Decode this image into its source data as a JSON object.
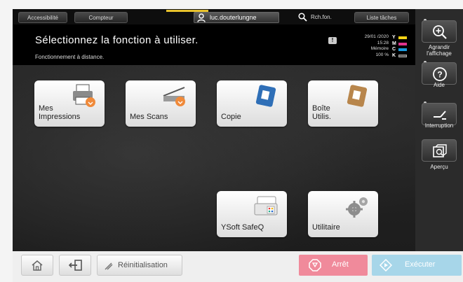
{
  "topbar": {
    "accessibility_label": "Accessibilité",
    "counter_label": "Compteur",
    "username": "luc.douterlungne",
    "search_label": "Rch.fon.",
    "job_list_label": "Liste tâches"
  },
  "header": {
    "title": "Sélectionnez la fonction à utiliser.",
    "subtitle": "Fonctionnement à distance.",
    "warning_glyph": "!",
    "date": "29/01 /2020",
    "time": "15:28",
    "memory_label": "Mémoire",
    "memory_value": "100 %",
    "toner": [
      {
        "letter": "Y",
        "color": "#f5d316"
      },
      {
        "letter": "M",
        "color": "#e0338d"
      },
      {
        "letter": "C",
        "color": "#1a9be0"
      },
      {
        "letter": "K",
        "color": "#555555"
      }
    ]
  },
  "tiles": [
    {
      "label_line1": "Mes",
      "label_line2": "Impressions",
      "icon": "printer-icon"
    },
    {
      "label_line1": "Mes Scans",
      "label_line2": "",
      "icon": "scanner-icon"
    },
    {
      "label_line1": "Copie",
      "label_line2": "",
      "icon": "copy-icon"
    },
    {
      "label_line1": "Boîte",
      "label_line2": "Utilis.",
      "icon": "box-icon"
    },
    {
      "label_line1": "YSoft SafeQ",
      "label_line2": "",
      "icon": "safeq-printer-icon"
    },
    {
      "label_line1": "Utilitaire",
      "label_line2": "",
      "icon": "gears-icon"
    }
  ],
  "side": {
    "zoom_label_1": "Agrandir",
    "zoom_label_2": "l'affichage",
    "help_label": "Aide",
    "interrupt_label": "Interruption",
    "preview_label": "Aperçu"
  },
  "bottom": {
    "reset_label": "Réinitialisation",
    "stop_label": "Arrêt",
    "start_label": "Exécuter"
  },
  "colors": {
    "accent_yellow": "#e9c32d",
    "stop_pink": "#f08a9b",
    "start_blue": "#a7d6e9"
  }
}
